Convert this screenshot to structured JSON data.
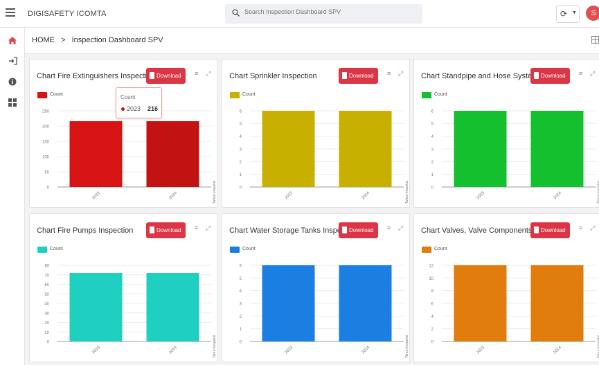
{
  "header": {
    "app_title": "DIGISAFETY ICOMTA",
    "search_placeholder": "Search Inspection Dashboard SPV",
    "avatar_initial": "S"
  },
  "breadcrumb": {
    "home": "HOME",
    "separator": ">",
    "current": "Inspection Dashboard SPV"
  },
  "card_common": {
    "download_label": "Download",
    "legend_label": "Count",
    "x_axis_label": "Tahun Inspeksi"
  },
  "tooltip": {
    "title": "Count",
    "category": "2023",
    "value": "216"
  },
  "cards": [
    {
      "title": "Chart Fire Extinguishers Inspection",
      "color": "#d61414"
    },
    {
      "title": "Chart Sprinkler Inspection",
      "color": "#c7b000"
    },
    {
      "title": "Chart Standpipe and Hose System",
      "color": "#14c02e"
    },
    {
      "title": "Chart Fire Pumps Inspection",
      "color": "#1fcfbf"
    },
    {
      "title": "Chart Water Storage Tanks Inspection",
      "color": "#1a7fe0"
    },
    {
      "title": "Chart Valves, Valve Components, and Trim",
      "color": "#e07d0c"
    }
  ],
  "chart_data": [
    {
      "type": "bar",
      "categories": [
        "2023",
        "2024"
      ],
      "values": [
        216,
        216
      ],
      "ylim": [
        0,
        250
      ],
      "ticks": [
        0,
        50,
        100,
        150,
        200,
        250
      ],
      "series": [
        {
          "name": "Count",
          "values": [
            216,
            216
          ]
        }
      ]
    },
    {
      "type": "bar",
      "categories": [
        "2023",
        "2024"
      ],
      "values": [
        6,
        6
      ],
      "ylim": [
        0,
        6
      ],
      "ticks": [
        0,
        1,
        2,
        3,
        4,
        5,
        6
      ],
      "series": [
        {
          "name": "Count",
          "values": [
            6,
            6
          ]
        }
      ]
    },
    {
      "type": "bar",
      "categories": [
        "2023",
        "2024"
      ],
      "values": [
        6,
        6
      ],
      "ylim": [
        0,
        6
      ],
      "ticks": [
        0,
        1,
        2,
        3,
        4,
        5,
        6
      ],
      "series": [
        {
          "name": "Count",
          "values": [
            6,
            6
          ]
        }
      ]
    },
    {
      "type": "bar",
      "categories": [
        "2023",
        "2024"
      ],
      "values": [
        72,
        72
      ],
      "ylim": [
        0,
        80
      ],
      "ticks": [
        0,
        10,
        20,
        30,
        40,
        50,
        60,
        70,
        80
      ],
      "series": [
        {
          "name": "Count",
          "values": [
            72,
            72
          ]
        }
      ]
    },
    {
      "type": "bar",
      "categories": [
        "2023",
        "2024"
      ],
      "values": [
        6,
        6
      ],
      "ylim": [
        0,
        6
      ],
      "ticks": [
        0,
        1,
        2,
        3,
        4,
        5,
        6
      ],
      "series": [
        {
          "name": "Count",
          "values": [
            6,
            6
          ]
        }
      ]
    },
    {
      "type": "bar",
      "categories": [
        "2023",
        "2024"
      ],
      "values": [
        12,
        12
      ],
      "ylim": [
        0,
        12
      ],
      "ticks": [
        0,
        2,
        4,
        6,
        8,
        10,
        12
      ],
      "series": [
        {
          "name": "Count",
          "values": [
            12,
            12
          ]
        }
      ]
    }
  ]
}
